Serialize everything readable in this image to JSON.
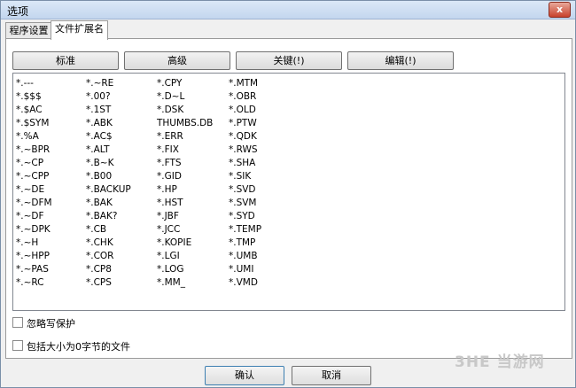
{
  "window": {
    "title": "选项",
    "close_label": "x"
  },
  "tabs": [
    {
      "label": "程序设置"
    },
    {
      "label": "文件扩展名"
    }
  ],
  "toolbar": {
    "standard_label": "标准",
    "advanced_label": "高级",
    "keyword_label": "关键(!)",
    "edit_label": "编辑(!)"
  },
  "extensions": {
    "col1": [
      "*.---",
      "*.$$$",
      "*.$AC",
      "*.$SYM",
      "*.%A",
      "*.~BPR",
      "*.~CP",
      "*.~CPP",
      "*.~DE",
      "*.~DFM",
      "*.~DF",
      "*.~DPK",
      "*.~H",
      "*.~HPP",
      "*.~PAS",
      "*.~RC"
    ],
    "col2": [
      "*.~RE",
      "*.00?",
      "*.1ST",
      "*.ABK",
      "*.AC$",
      "*.ALT",
      "*.B~K",
      "*.B00",
      "*.BACKUP",
      "*.BAK",
      "*.BAK?",
      "*.CB",
      "*.CHK",
      "*.COR",
      "*.CP8",
      "*.CPS"
    ],
    "col3": [
      "*.CPY",
      "*.D~L",
      "*.DSK",
      "THUMBS.DB",
      "*.ERR",
      "*.FIX",
      "*.FTS",
      "*.GID",
      "*.HP",
      "*.HST",
      "*.JBF",
      "*.JCC",
      "*.KOPIE",
      "*.LGI",
      "*.LOG",
      "*.MM_"
    ],
    "col4": [
      "*.MTM",
      "*.OBR",
      "*.OLD",
      "*.PTW",
      "*.QDK",
      "*.RWS",
      "*.SHA",
      "*.SIK",
      "*.SVD",
      "*.SVM",
      "*.SYD",
      "*.TEMP",
      "*.TMP",
      "*.UMB",
      "*.UMI",
      "*.VMD"
    ]
  },
  "options": {
    "ignore_write_protect": {
      "label": "忽略写保护",
      "checked": false
    },
    "include_zero_byte": {
      "label": "包括大小为0字节的文件",
      "checked": false
    }
  },
  "dialog": {
    "ok_label": "确认",
    "cancel_label": "取消"
  },
  "watermark": {
    "text": "3HE 当游网"
  }
}
